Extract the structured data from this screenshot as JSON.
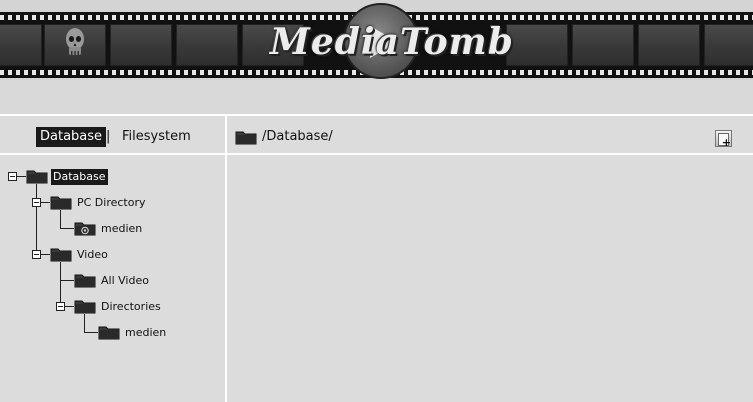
{
  "app": {
    "logo_text": "MediaTomb"
  },
  "view_switcher": {
    "database_label": "Database",
    "separator": "|",
    "filesystem_label": "Filesystem"
  },
  "path_bar": {
    "current_path": "/Database/",
    "add_icon": "add-item-icon"
  },
  "tree": {
    "root": {
      "label": "Database",
      "selected": true,
      "expanded": true
    },
    "nodes": [
      {
        "label": "PC Directory",
        "expanded": true,
        "icon": "folder-icon"
      },
      {
        "label": "medien",
        "icon": "camera-folder-icon"
      },
      {
        "label": "Video",
        "expanded": true,
        "icon": "folder-icon"
      },
      {
        "label": "All Video",
        "icon": "folder-icon"
      },
      {
        "label": "Directories",
        "expanded": true,
        "icon": "folder-icon"
      },
      {
        "label": "medien",
        "icon": "folder-icon"
      }
    ]
  },
  "colors": {
    "background": "#d9d9d9",
    "selected_bg": "#1a1a1a",
    "selected_fg": "#ffffff",
    "divider": "#ffffff"
  }
}
